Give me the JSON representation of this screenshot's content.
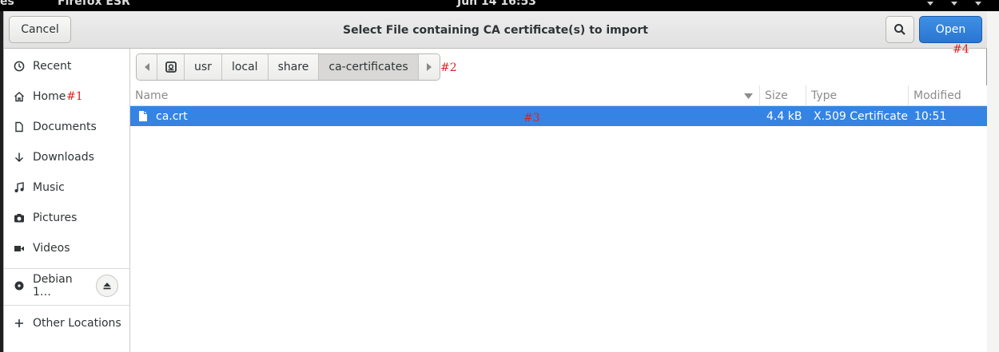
{
  "topbar": {
    "left_fragment": "es",
    "app_name": "Firefox ESR",
    "clock": "Jun 14  16:53"
  },
  "dialog": {
    "title": "Select File containing CA certificate(s) to import",
    "cancel_label": "Cancel",
    "open_label": "Open"
  },
  "sidebar": {
    "items": [
      {
        "label": "Recent",
        "icon": "clock-icon"
      },
      {
        "label": "Home",
        "icon": "home-icon"
      },
      {
        "label": "Documents",
        "icon": "document-icon"
      },
      {
        "label": "Downloads",
        "icon": "download-icon"
      },
      {
        "label": "Music",
        "icon": "music-icon"
      },
      {
        "label": "Pictures",
        "icon": "camera-icon"
      },
      {
        "label": "Videos",
        "icon": "video-icon"
      },
      {
        "label": "Debian 1…",
        "icon": "disc-icon"
      },
      {
        "label": "Other Locations",
        "icon": "plus-icon"
      }
    ]
  },
  "path": {
    "segments": [
      "usr",
      "local",
      "share",
      "ca-certificates"
    ]
  },
  "columns": {
    "name": "Name",
    "size": "Size",
    "type": "Type",
    "modified": "Modified"
  },
  "files": [
    {
      "name": "ca.crt",
      "size": "4.4 kB",
      "type": "X.509 Certificate",
      "modified": "10:51",
      "selected": true
    }
  ],
  "annotations": {
    "m1": "#1",
    "m2": "#2",
    "m3": "#3",
    "m4": "#4"
  },
  "colors": {
    "accent": "#3584e4",
    "annotation": "#e02020"
  }
}
